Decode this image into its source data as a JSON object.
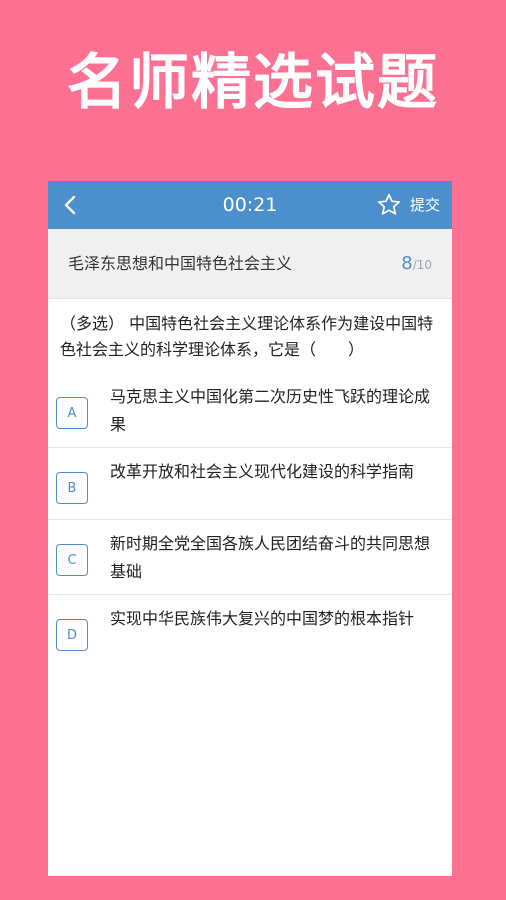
{
  "banner": {
    "title": "名师精选试题"
  },
  "topbar": {
    "timer": "00:21",
    "submit_label": "提交"
  },
  "subject": {
    "title": "毛泽东思想和中国特色社会主义",
    "current": "8",
    "total": "/10"
  },
  "question": {
    "text": "（多选） 中国特色社会主义理论体系作为建设中国特色社会主义的科学理论体系，它是（　　）"
  },
  "options": [
    {
      "key": "A",
      "text": "马克思主义中国化第二次历史性飞跃的理论成果"
    },
    {
      "key": "B",
      "text": "改革开放和社会主义现代化建设的科学指南"
    },
    {
      "key": "C",
      "text": "新时期全党全国各族人民团结奋斗的共同思想基础"
    },
    {
      "key": "D",
      "text": "实现中华民族伟大复兴的中国梦的根本指针"
    }
  ],
  "colors": {
    "background": "#fc7192",
    "accent": "#4b8fcd"
  },
  "icons": {
    "back": "chevron-left-icon",
    "favorite": "star-outline-icon"
  }
}
